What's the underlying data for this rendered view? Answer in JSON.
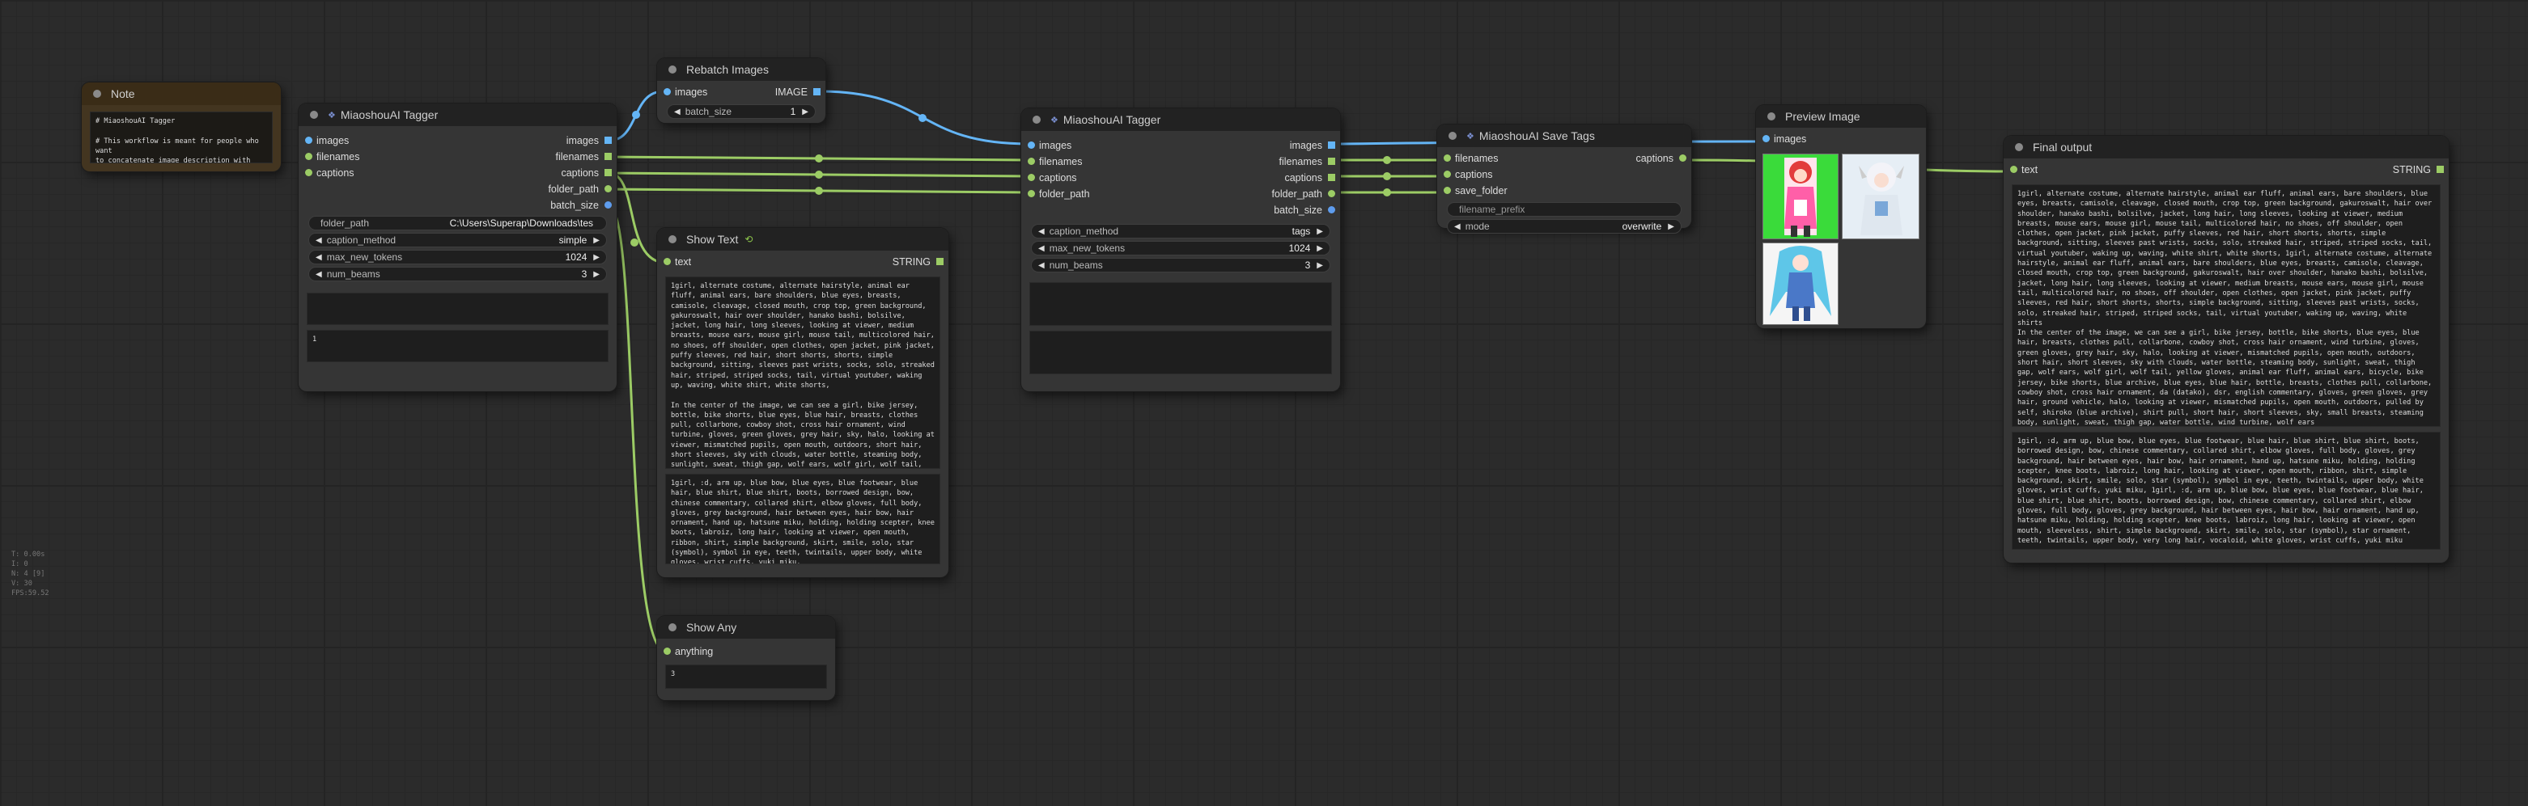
{
  "note": {
    "title": "Note",
    "text": "# MiaoshouAI Tagger\n\n# This workflow is meant for people who want\nto concatenate image description with tags"
  },
  "tagger1": {
    "title": "MiaoshouAI Tagger",
    "inputs": [
      "images",
      "filenames",
      "captions"
    ],
    "outputs": [
      "images",
      "filenames",
      "captions",
      "folder_path",
      "batch_size"
    ],
    "folder_path_label": "folder_path",
    "folder_path_value": "C:\\Users\\Superap\\Downloads\\tes",
    "caption_method_label": "caption_method",
    "caption_method_value": "simple",
    "max_new_tokens_label": "max_new_tokens",
    "max_new_tokens_value": "1024",
    "num_beams_label": "num_beams",
    "num_beams_value": "3",
    "box2_text": "1"
  },
  "rebatch": {
    "title": "Rebatch Images",
    "input": "images",
    "output": "IMAGE",
    "batch_size_label": "batch_size",
    "batch_size_value": "1"
  },
  "tagger2": {
    "title": "MiaoshouAI Tagger",
    "inputs": [
      "images",
      "filenames",
      "captions",
      "folder_path"
    ],
    "outputs": [
      "images",
      "filenames",
      "captions",
      "folder_path",
      "batch_size"
    ],
    "caption_method_label": "caption_method",
    "caption_method_value": "tags",
    "max_new_tokens_label": "max_new_tokens",
    "max_new_tokens_value": "1024",
    "num_beams_label": "num_beams",
    "num_beams_value": "3"
  },
  "save_tags": {
    "title": "MiaoshouAI Save Tags",
    "inputs": [
      "filenames",
      "captions",
      "save_folder"
    ],
    "output": "captions",
    "filename_prefix_placeholder": "filename_prefix",
    "mode_label": "mode",
    "mode_value": "overwrite"
  },
  "show_text": {
    "title": "Show Text",
    "input": "text",
    "output": "STRING",
    "text1": "1girl, alternate costume, alternate hairstyle, animal ear fluff, animal ears, bare shoulders, blue eyes, breasts, camisole, cleavage, closed mouth, crop top, green background, gakuroswalt, hair over shoulder, hanako bashi, bolsilve, jacket, long hair, long sleeves, looking at viewer, medium breasts, mouse ears, mouse girl, mouse tail, multicolored hair, no shoes, off shoulder, open clothes, open jacket, pink jacket, puffy sleeves, red hair, short shorts, shorts, simple background, sitting, sleeves past wrists, socks, solo, streaked hair, striped, striped socks, tail, virtual youtuber, waking up, waving, white shirt, white shorts,\n\nIn the center of the image, we can see a girl, bike jersey, bottle, bike shorts, blue eyes, blue hair, breasts, clothes pull, collarbone, cowboy shot, cross hair ornament, wind turbine, gloves, green gloves, grey hair, sky, halo, looking at viewer, mismatched pupils, open mouth, outdoors, short hair, short sleeves, sky with clouds, water bottle, steaming body, sunlight, sweat, thigh gap, wolf ears, wolf girl, wolf tail, yellow gloves,",
    "text2": "1girl, :d, arm up, blue bow, blue eyes, blue footwear, blue hair, blue shirt, blue shirt, boots, borrowed design, bow, chinese commentary, collared shirt, elbow gloves, full body, gloves, grey background, hair between eyes, hair bow, hair ornament, hand up, hatsune miku, holding, holding scepter, knee boots, labroiz, long hair, looking at viewer, open mouth, ribbon, shirt, simple background, skirt, smile, solo, star (symbol), symbol in eye, teeth, twintails, upper body, white gloves, wrist cuffs, yuki miku,"
  },
  "show_any": {
    "title": "Show Any",
    "input": "anything",
    "value": "3"
  },
  "preview": {
    "title": "Preview Image",
    "input": "images"
  },
  "final": {
    "title": "Final output",
    "input": "text",
    "output": "STRING",
    "text1": "1girl, alternate costume, alternate hairstyle, animal ear fluff, animal ears, bare shoulders, blue eyes, breasts, camisole, cleavage, closed mouth, crop top, green background, gakuroswalt, hair over shoulder, hanako bashi, bolsilve, jacket, long hair, long sleeves, looking at viewer, medium breasts, mouse ears, mouse girl, mouse tail, multicolored hair, no shoes, off shoulder, open clothes, open jacket, pink jacket, puffy sleeves, red hair, short shorts, shorts, simple background, sitting, sleeves past wrists, socks, solo, streaked hair, striped, striped socks, tail, virtual youtuber, waking up, waving, white shirt, white shorts, 1girl, alternate costume, alternate hairstyle, animal ear fluff, animal ears, bare shoulders, blue eyes, breasts, camisole, cleavage, closed mouth, crop top, green background, gakuroswalt, hair over shoulder, hanako bashi, bolsilve, jacket, long hair, long sleeves, looking at viewer, medium breasts, mouse ears, mouse girl, mouse tail, multicolored hair, no shoes, off shoulder, open clothes, open jacket, pink jacket, puffy sleeves, red hair, short shorts, shorts, simple background, sitting, sleeves past wrists, socks, solo, streaked hair, striped, striped socks, tail, virtual youtuber, waking up, waving, white shirts\nIn the center of the image, we can see a girl, bike jersey, bottle, bike shorts, blue eyes, blue hair, breasts, clothes pull, collarbone, cowboy shot, cross hair ornament, wind turbine, gloves, green gloves, grey hair, sky, halo, looking at viewer, mismatched pupils, open mouth, outdoors, short hair, short sleeves, sky with clouds, water bottle, steaming body, sunlight, sweat, thigh gap, wolf ears, wolf girl, wolf tail, yellow gloves, animal ear fluff, animal ears, bicycle, bike jersey, bike shorts, blue archive, blue eyes, blue hair, bottle, breasts, clothes pull, collarbone, cowboy shot, cross hair ornament, da (datako), dsr, english commentary, gloves, green gloves, grey hair, ground vehicle, halo, looking at viewer, mismatched pupils, open mouth, outdoors, pulled by self, shiroko (blue archive), shirt pull, short hair, short sleeves, sky, small breasts, steaming body, sunlight, sweat, thigh gap, water bottle, wind turbine, wolf ears",
    "text2": "1girl, :d, arm up, blue bow, blue eyes, blue footwear, blue hair, blue shirt, blue shirt, boots, borrowed design, bow, chinese commentary, collared shirt, elbow gloves, full body, gloves, grey background, hair between eyes, hair bow, hair ornament, hand up, hatsune miku, holding, holding scepter, knee boots, labroiz, long hair, looking at viewer, open mouth, ribbon, shirt, simple background, skirt, smile, solo, star (symbol), symbol in eye, teeth, twintails, upper body, white gloves, wrist cuffs, yuki miku, 1girl, :d, arm up, blue bow, blue eyes, blue footwear, blue hair, blue shirt, blue shirt, boots, borrowed design, bow, chinese commentary, collared shirt, elbow gloves, full body, gloves, grey background, hair between eyes, hair bow, hair ornament, hand up, hatsune miku, holding, holding scepter, knee boots, labroiz, long hair, looking at viewer, open mouth, sleeveless, shirt, simple background, skirt, smile, solo, star (symbol), star ornament, teeth, twintails, upper body, very long hair, vocaloid, white gloves, wrist cuffs, yuki miku"
  },
  "hud": [
    "T: 0.00s",
    "I: 0",
    "N: 4 [9]",
    "V: 30",
    "FPS:59.52"
  ],
  "colors": {
    "image_wire": "#64b5f6",
    "string_wire": "#9ccc65"
  }
}
